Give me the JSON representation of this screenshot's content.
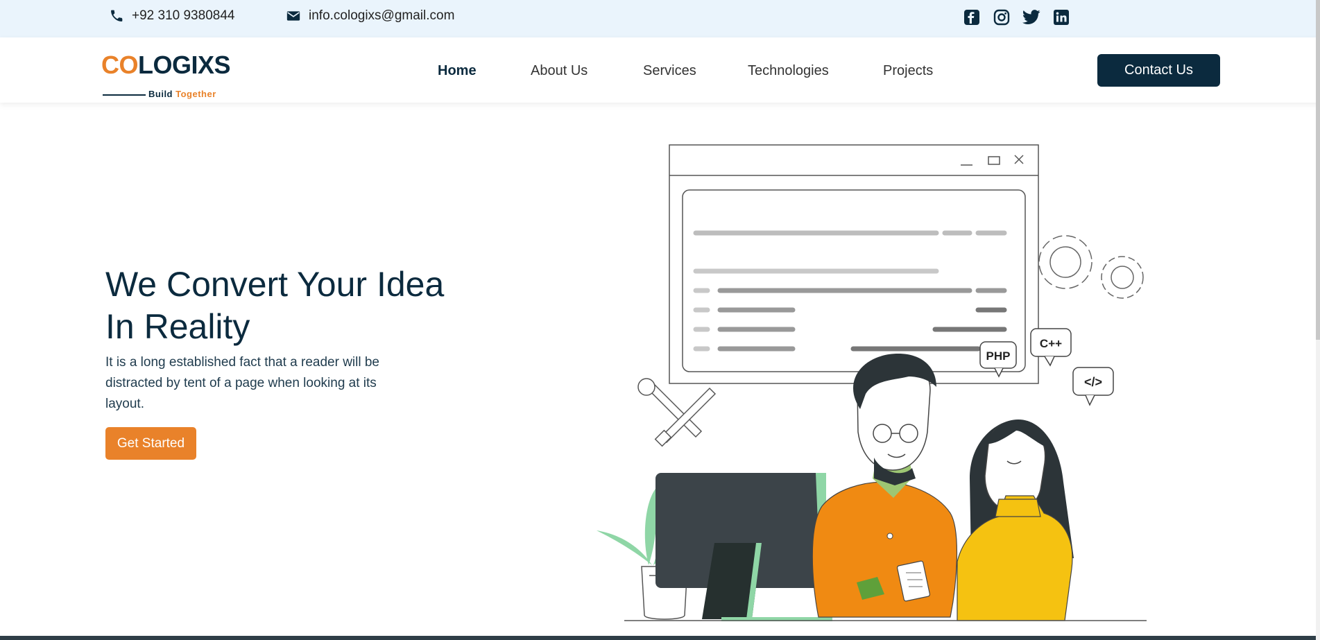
{
  "topbar": {
    "phone": "+92 310 9380844",
    "email": "info.cologixs@gmail.com",
    "socials": [
      {
        "name": "facebook-icon"
      },
      {
        "name": "instagram-icon"
      },
      {
        "name": "twitter-icon"
      },
      {
        "name": "linkedin-icon"
      }
    ]
  },
  "brand": {
    "logo_part1": "CO",
    "logo_part2": "LOGIXS",
    "tagline_part1": "Build",
    "tagline_part2": "Together",
    "colors": {
      "navy": "#0b2a3e",
      "orange": "#e9822a"
    }
  },
  "nav": {
    "items": [
      {
        "label": "Home",
        "active": true
      },
      {
        "label": "About Us",
        "active": false
      },
      {
        "label": "Services",
        "active": false
      },
      {
        "label": "Technologies",
        "active": false
      },
      {
        "label": "Projects",
        "active": false
      }
    ],
    "cta_label": "Contact Us"
  },
  "hero": {
    "title": "We Convert Your Idea In Reality",
    "text": "It is a long established fact that a reader will be distracted by tent of a page when looking at its layout.",
    "button_label": "Get Started",
    "illustration_badges": [
      "PHP",
      "C++",
      "</>"
    ]
  }
}
